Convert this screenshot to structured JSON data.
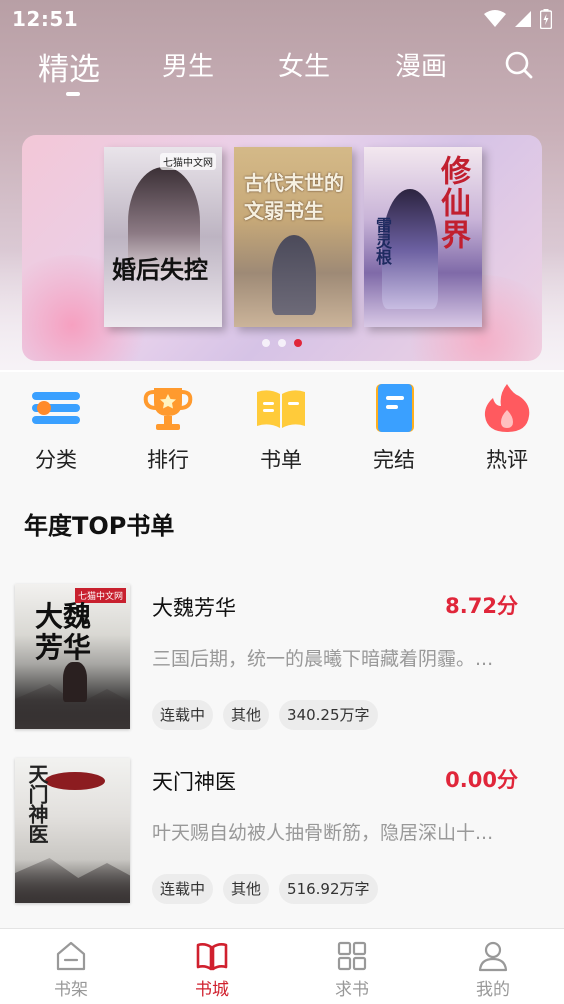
{
  "status_bar": {
    "time": "12:51"
  },
  "top_tabs": [
    {
      "label": "精选",
      "active": true
    },
    {
      "label": "男生",
      "active": false
    },
    {
      "label": "女生",
      "active": false
    },
    {
      "label": "漫画",
      "active": false
    }
  ],
  "banner": {
    "books": [
      {
        "title": "婚后失控",
        "badge": "七猫中文网"
      },
      {
        "title": "古代末世的文弱书生"
      },
      {
        "title": "修仙界",
        "subtitle": "雷灵根"
      }
    ],
    "dots": 3,
    "active_dot": 2
  },
  "quick_nav": [
    {
      "label": "分类",
      "icon": "category-icon"
    },
    {
      "label": "排行",
      "icon": "trophy-icon"
    },
    {
      "label": "书单",
      "icon": "open-book-icon"
    },
    {
      "label": "完结",
      "icon": "notebook-icon"
    },
    {
      "label": "热评",
      "icon": "flame-icon"
    }
  ],
  "section": {
    "title": "年度TOP书单",
    "books": [
      {
        "name": "大魏芳华",
        "score": "8.72分",
        "desc": "三国后期，统一的晨曦下暗藏着阴霾。...",
        "tags": [
          "连载中",
          "其他",
          "340.25万字"
        ],
        "cover_title": "大魏芳华",
        "cover_badge": "七猫中文网"
      },
      {
        "name": "天门神医",
        "score": "0.00分",
        "desc": "叶天赐自幼被人抽骨断筋，隐居深山十...",
        "tags": [
          "连载中",
          "其他",
          "516.92万字"
        ],
        "cover_title": "天门神医"
      }
    ]
  },
  "bottom_nav": [
    {
      "label": "书架",
      "icon": "bookshelf-icon",
      "active": false
    },
    {
      "label": "书城",
      "icon": "bookstore-icon",
      "active": true
    },
    {
      "label": "求书",
      "icon": "grid-icon",
      "active": false
    },
    {
      "label": "我的",
      "icon": "profile-icon",
      "active": false
    }
  ],
  "colors": {
    "accent": "#e0263a",
    "nav_active": "#d0202e",
    "muted": "#999999"
  }
}
